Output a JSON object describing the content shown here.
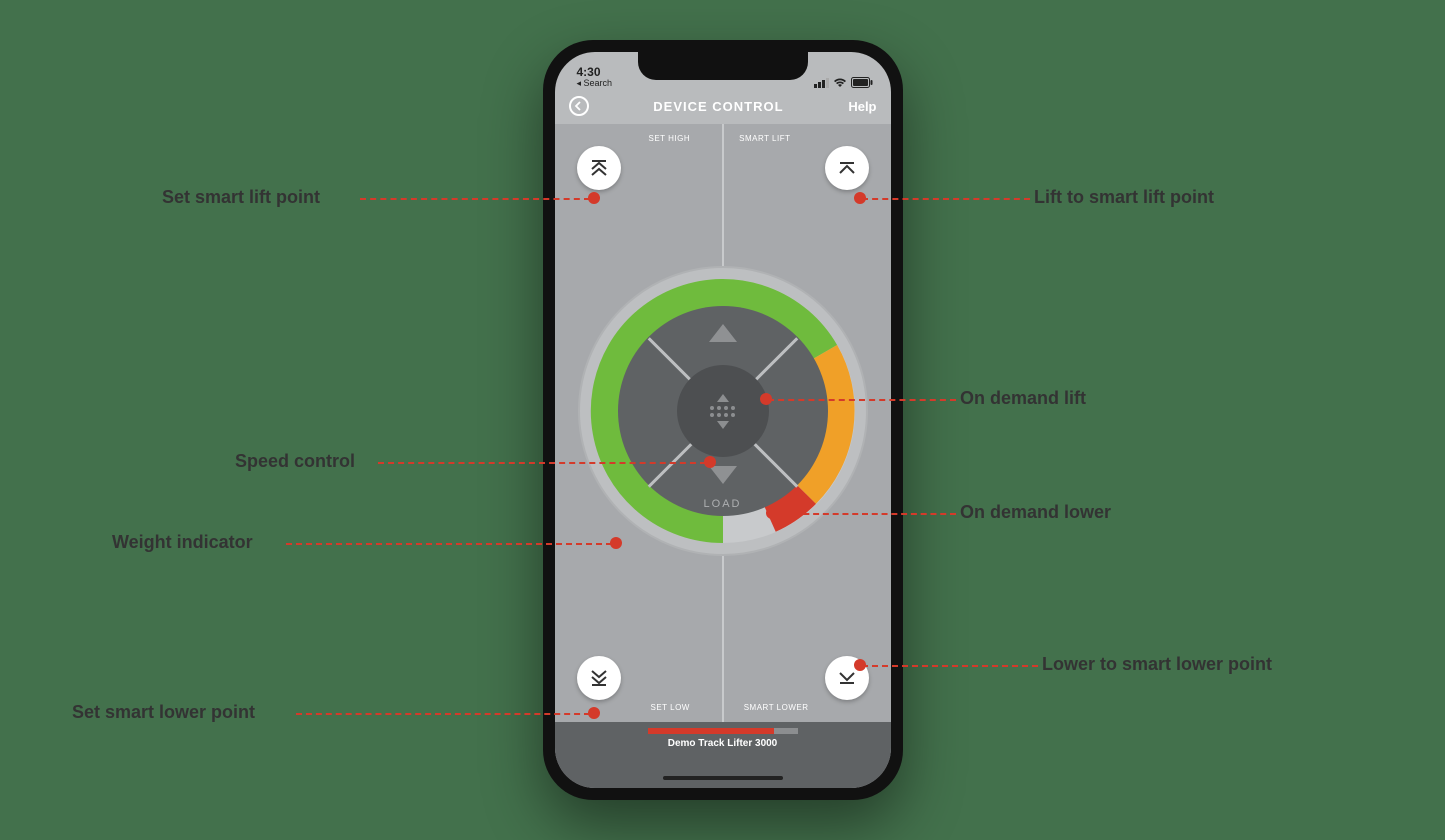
{
  "status": {
    "time": "4:30",
    "back_app": "◂ Search"
  },
  "nav": {
    "title": "DEVICE CONTROL",
    "help": "Help"
  },
  "labels": {
    "set_high": "SET HIGH",
    "smart_lift": "SMART LIFT",
    "set_low": "SET LOW",
    "smart_lower": "SMART LOWER",
    "load": "LOAD"
  },
  "footer": {
    "device_name": "Demo Track Lifter 3000"
  },
  "callouts": {
    "set_smart_lift": "Set smart lift point",
    "lift_to_smart": "Lift to smart lift point",
    "on_demand_lift": "On demand lift",
    "speed_control": "Speed control",
    "on_demand_lower": "On demand lower",
    "weight_indicator": "Weight indicator",
    "lower_to_smart": "Lower to smart lower point",
    "set_smart_lower": "Set smart lower point"
  }
}
